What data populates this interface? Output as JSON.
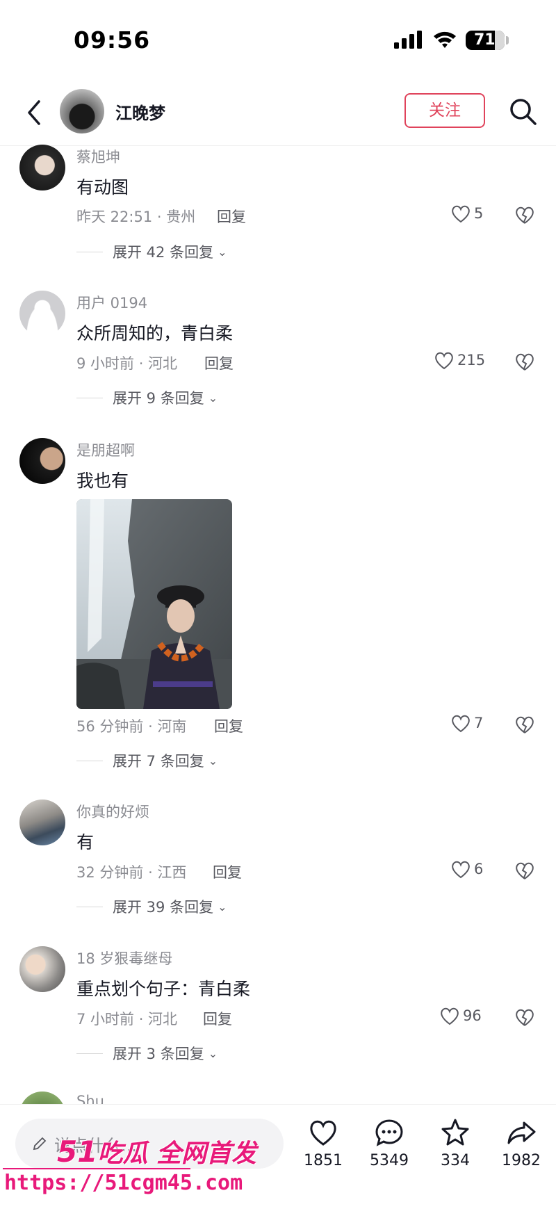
{
  "status_bar": {
    "time": "09:56",
    "battery": "71"
  },
  "header": {
    "author": "江晚梦",
    "follow_label": "关注"
  },
  "comments": [
    {
      "user": "蔡旭坤",
      "text": "有动图",
      "meta": "昨天 22:51 · 贵州",
      "reply": "回复",
      "likes": "5",
      "expand": "展开 42 条回复"
    },
    {
      "user": "用户 0194",
      "text": "众所周知的，青白柔",
      "meta": "9 小时前 · 河北",
      "reply": "回复",
      "likes": "215",
      "expand": "展开 9 条回复"
    },
    {
      "user": "是朋超啊",
      "text": "我也有",
      "meta": "56 分钟前 · 河南",
      "reply": "回复",
      "likes": "7",
      "expand": "展开 7 条回复"
    },
    {
      "user": "你真的好烦",
      "text": "有",
      "meta": "32 分钟前 · 江西",
      "reply": "回复",
      "likes": "6",
      "expand": "展开 39 条回复"
    },
    {
      "user": "18 岁狠毒继母",
      "text": "重点划个句子：青白柔",
      "meta": "7 小时前 · 河北",
      "reply": "回复",
      "likes": "96",
      "expand": "展开 3 条回复"
    },
    {
      "user": "Shu"
    }
  ],
  "bottom_bar": {
    "input_placeholder": "说点什么...",
    "like_count": "1851",
    "comment_count": "5349",
    "favorite_count": "334",
    "share_count": "1982"
  },
  "watermark": {
    "line1_num": "51",
    "line1_text": "吃瓜 全网首发",
    "line2": "https://51cgm45.com"
  },
  "colors": {
    "accent": "#e0435b",
    "watermark": "#e8197a",
    "text": "#161823",
    "muted": "#8a8b91"
  }
}
